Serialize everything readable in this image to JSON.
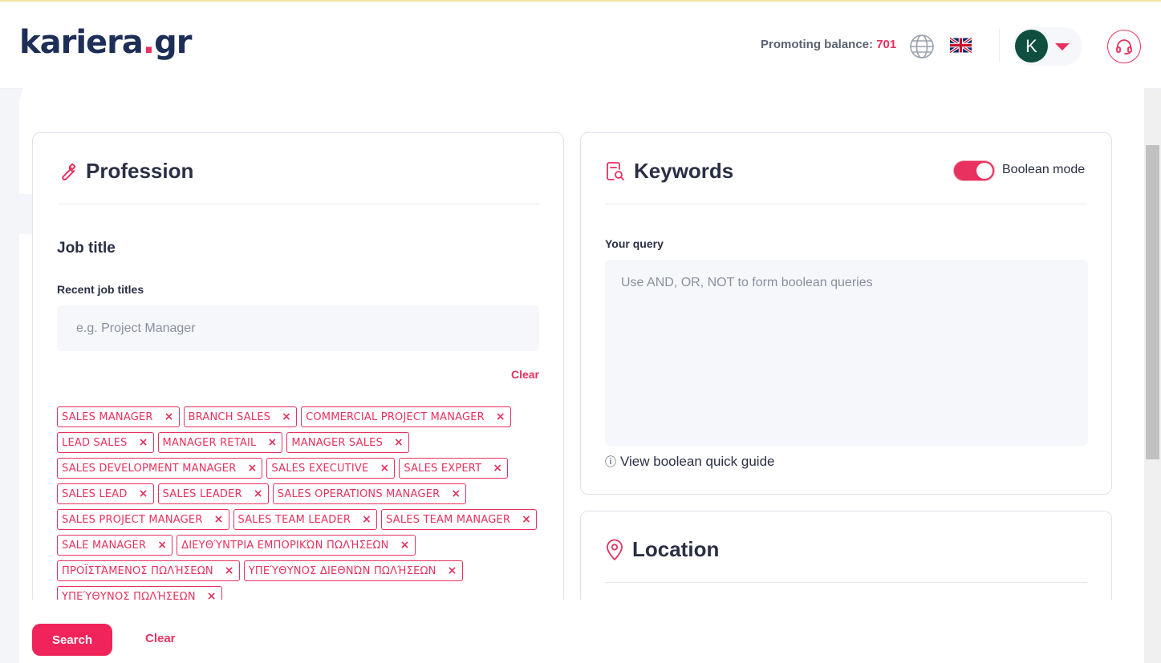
{
  "header": {
    "logo_main": "kariera",
    "logo_dot": ".",
    "logo_tld": "gr",
    "balance_label": "Promoting balance:",
    "balance_value": "701",
    "user_initial": "K"
  },
  "profession": {
    "title": "Profession",
    "job_heading": "Job title",
    "recent_label": "Recent job titles",
    "input_placeholder": "e.g. Project Manager",
    "clear_label": "Clear",
    "tags": [
      "SALES MANAGER",
      "BRANCH SALES",
      "COMMERCIAL PROJECT MANAGER",
      "LEAD SALES",
      "MANAGER RETAIL",
      "MANAGER SALES",
      "SALES DEVELOPMENT MANAGER",
      "SALES EXECUTIVE",
      "SALES EXPERT",
      "SALES LEAD",
      "SALES LEADER",
      "SALES OPERATIONS MANAGER",
      "SALES PROJECT MANAGER",
      "SALES TEAM LEADER",
      "SALES TEAM MANAGER",
      "SALE MANAGER",
      "ΔΙΕΥΘΎΝΤΡΙΑ ΕΜΠΟΡΙΚΏΝ ΠΩΛΉΣΕΩΝ",
      "ΠΡΟΪΣΤΆΜΕΝΟΣ ΠΩΛΉΣΕΩΝ",
      "ΥΠΕΎΘΥΝΟΣ ΔΙΕΘΝΏΝ ΠΩΛΉΣΕΩΝ",
      "ΥΠΕΎΘΥΝΟΣ ΠΩΛΉΣΕΩΝ"
    ],
    "tag_remove_glyph": "×"
  },
  "keywords": {
    "title": "Keywords",
    "boolean_label": "Boolean mode",
    "boolean_on": true,
    "query_label": "Your query",
    "query_placeholder": "Use AND, OR, NOT to form boolean queries",
    "guide_label": "View boolean quick guide",
    "guide_icon": "ⓘ"
  },
  "location": {
    "title": "Location"
  },
  "footer": {
    "search_label": "Search",
    "clear_label": "Clear"
  },
  "colors": {
    "accent": "#e8315e",
    "brand_navy": "#1d2e57",
    "avatar_bg": "#0f4f3f"
  }
}
